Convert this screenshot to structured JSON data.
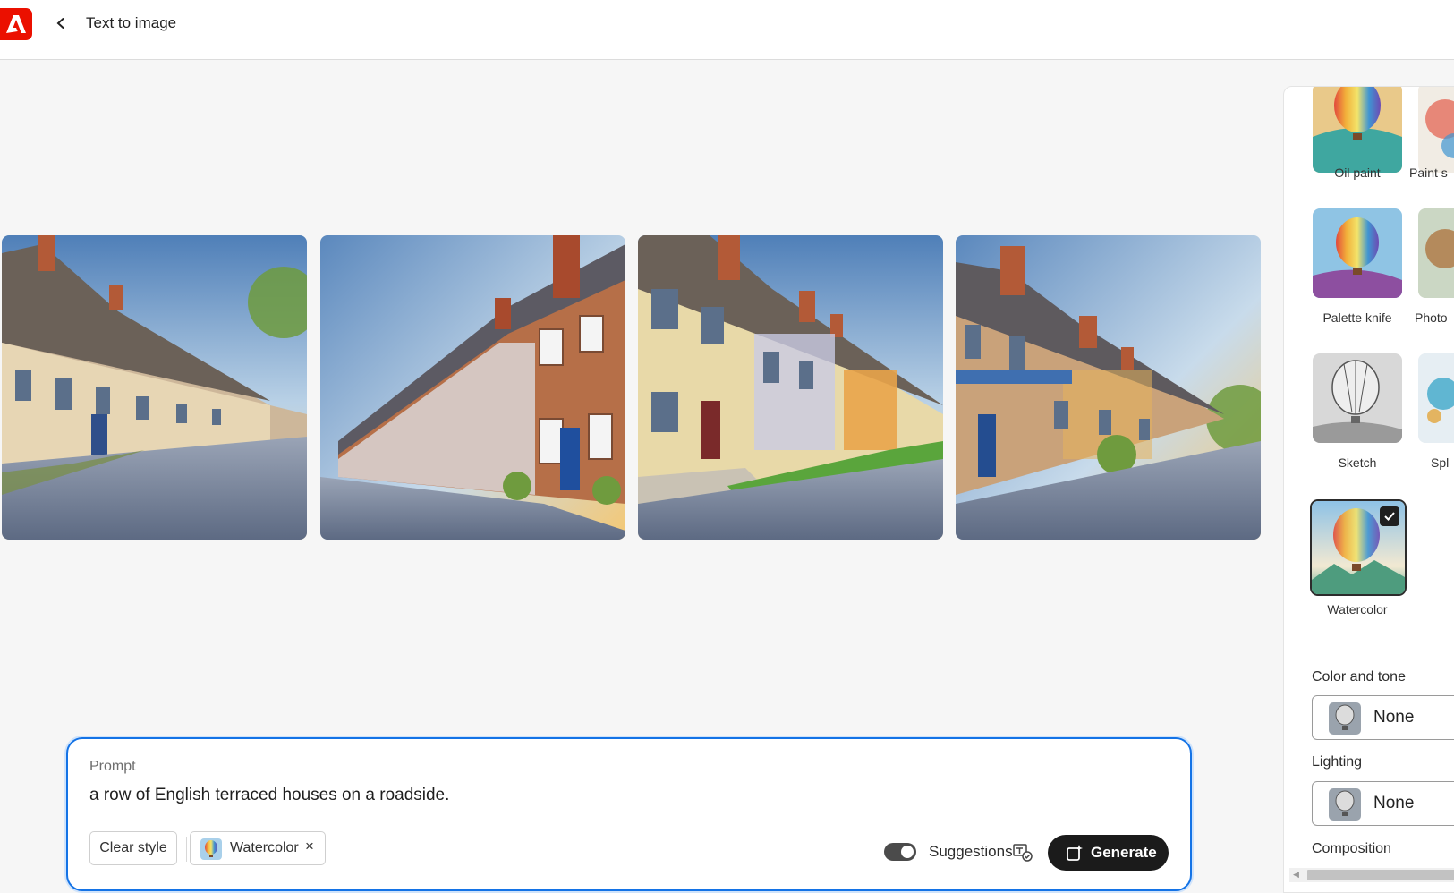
{
  "header": {
    "app_logo": "adobe-logo",
    "back_icon": "chevron-left-icon",
    "title": "Text to image"
  },
  "gallery": {
    "images": [
      {
        "name": "generated-image-1"
      },
      {
        "name": "generated-image-2"
      },
      {
        "name": "generated-image-3"
      },
      {
        "name": "generated-image-4"
      }
    ]
  },
  "styles_panel": {
    "styles": [
      {
        "label": "Oil paint",
        "selected": false
      },
      {
        "label": "Paint s",
        "selected": false
      },
      {
        "label": "Palette knife",
        "selected": false
      },
      {
        "label": "Photo",
        "selected": false
      },
      {
        "label": "Sketch",
        "selected": false
      },
      {
        "label": "Spl",
        "selected": false
      },
      {
        "label": "Watercolor",
        "selected": true
      }
    ],
    "color_and_tone": {
      "title": "Color and tone",
      "value": "None"
    },
    "lighting": {
      "title": "Lighting",
      "value": "None"
    },
    "composition": {
      "title": "Composition"
    }
  },
  "prompt": {
    "label": "Prompt",
    "text": "a row of English terraced houses on a roadside.",
    "clear_style_label": "Clear style",
    "style_chip_label": "Watercolor",
    "style_chip_remove": "×",
    "suggestions_label": "Suggestions",
    "suggestions_enabled": true,
    "generate_label": "Generate"
  },
  "colors": {
    "brand_red": "#eb1000",
    "prompt_border": "#1473e6",
    "generate_bg": "#1b1b1b"
  }
}
